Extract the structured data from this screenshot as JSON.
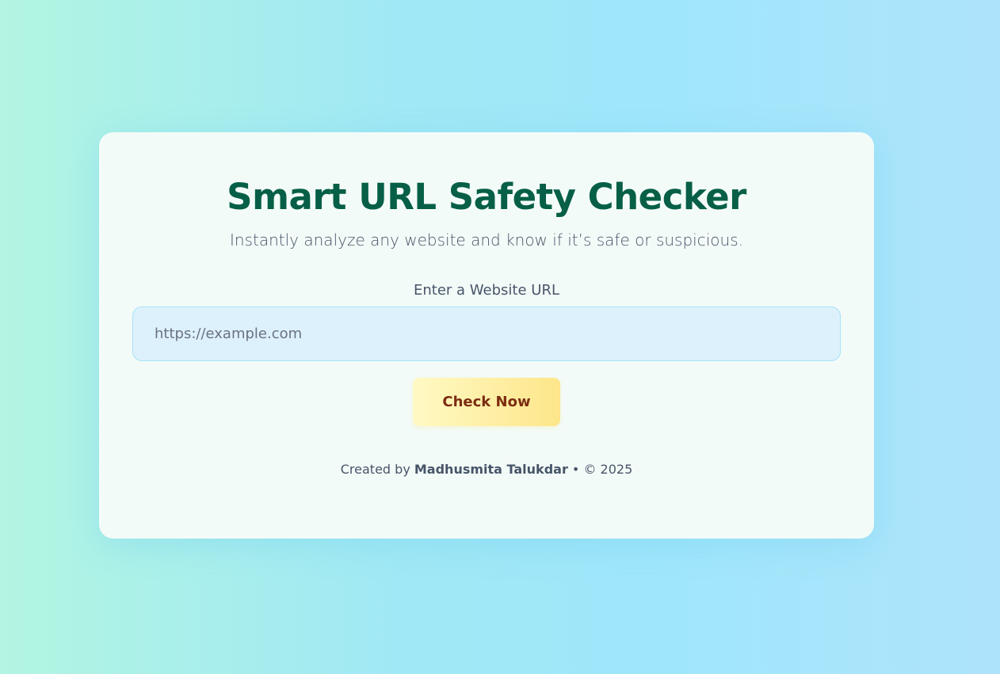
{
  "header": {
    "title": "Smart URL Safety Checker",
    "subtitle": "Instantly analyze any website and know if it’s safe or suspicious."
  },
  "form": {
    "label": "Enter a Website URL",
    "url_value": "",
    "url_placeholder": "https://example.com",
    "submit_label": "Check Now"
  },
  "footer": {
    "prefix": "Created by",
    "author": "Madhusmita Talukdar",
    "suffix": "• © 2025"
  },
  "colors": {
    "title": "#065f46",
    "accent_button": "#fde68a",
    "button_text": "#7c2d12",
    "input_bg": "#ddf1fd"
  }
}
